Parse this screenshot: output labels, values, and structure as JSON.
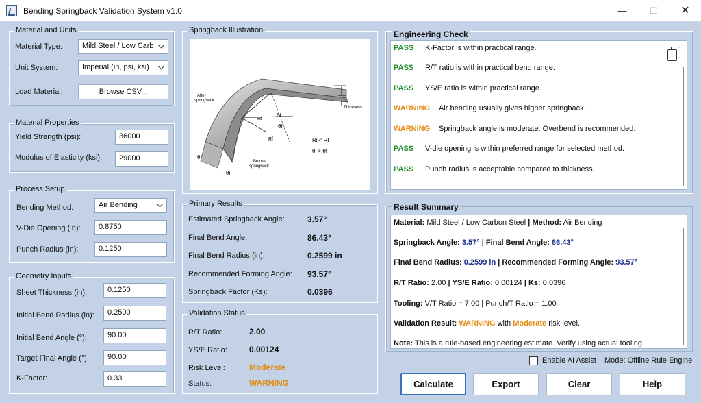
{
  "window": {
    "title": "Bending Springback Validation System v1.0",
    "min": "—",
    "max": "☐",
    "close": "✕"
  },
  "material_units": {
    "title": "Material and Units",
    "material_type_label": "Material Type:",
    "material_type_value": "Mild Steel / Low Carbon Steel",
    "unit_system_label": "Unit System:",
    "unit_system_value": "Imperial (in, psi, ksi)",
    "load_label": "Load Material:",
    "browse_button": "Browse CSV..."
  },
  "material_props": {
    "title": "Material Properties",
    "yield_label": "Yield Strength (psi):",
    "yield_value": "36000",
    "modulus_label": "Modulus of Elasticity (ksi):",
    "modulus_value": "29000"
  },
  "process": {
    "title": "Process Setup",
    "method_label": "Bending Method:",
    "method_value": "Air Bending",
    "vdie_label": "V-Die Opening (in):",
    "vdie_value": "0.8750",
    "punch_label": "Punch Radius (in):",
    "punch_value": "0.1250"
  },
  "geometry": {
    "title": "Geometry Inputs",
    "thickness_label": "Sheet Thickness (in):",
    "thickness_value": "0.1250",
    "radius_label": "Initial Bend Radius (in):",
    "radius_value": "0.2500",
    "angle_label": "Initial Bend Angle (°):",
    "angle_value": "90.00",
    "target_label": "Target Final Angle (°)",
    "target_value": "90.00",
    "kfactor_label": "K-Factor:",
    "kfactor_value": "0.33"
  },
  "illustration": {
    "title": "Springback Illustration",
    "after": "After",
    "after2": "springback",
    "before": "Before",
    "before2": "springback",
    "thickness": "Thickness",
    "ri": "Ri",
    "rf": "Rf",
    "thi": "θi",
    "thf": "θf",
    "thf2": "θf",
    "thi2": "θi",
    "rel1": "Ri < Rf",
    "rel2": "θi > θf"
  },
  "primary_results": {
    "title": "Primary Results",
    "rows": [
      {
        "label": "Estimated Springback Angle:",
        "value": "3.57°"
      },
      {
        "label": "Final Bend Angle:",
        "value": "86.43°"
      },
      {
        "label": "Final Bend Radius (in):",
        "value": "0.2599 in"
      },
      {
        "label": "Recommended Forming Angle:",
        "value": "93.57°"
      },
      {
        "label": "Springback Factor (Ks):",
        "value": "0.0396"
      }
    ]
  },
  "validation": {
    "title": "Validation Status",
    "rt_label": "R/T Ratio:",
    "rt_value": "2.00",
    "yse_label": "YS/E Ratio:",
    "yse_value": "0.00124",
    "risk_label": "Risk Level:",
    "risk_value": "Moderate",
    "status_label": "Status:",
    "status_value": "WARNING"
  },
  "engineering_check": {
    "title": "Engineering Check",
    "rows": [
      {
        "status": "PASS",
        "text": "K-Factor is within practical range."
      },
      {
        "status": "PASS",
        "text": "R/T ratio is within practical bend range."
      },
      {
        "status": "PASS",
        "text": "YS/E ratio is within practical range."
      },
      {
        "status": "WARNING",
        "text": "Air bending usually gives higher springback."
      },
      {
        "status": "WARNING",
        "text": "Springback angle is moderate. Overbend is recommended."
      },
      {
        "status": "PASS",
        "text": "V-die opening is within preferred range for selected method."
      },
      {
        "status": "PASS",
        "text": "Punch radius is acceptable compared to thickness."
      }
    ]
  },
  "result_summary": {
    "title": "Result Summary",
    "material_key": "Material:",
    "material_val": "Mild Steel / Low Carbon Steel",
    "sep": "|",
    "method_key": "Method:",
    "method_val": "Air Bending",
    "sb_key": "Springback Angle:",
    "sb_val": "3.57°",
    "fba_key": "Final Bend Angle:",
    "fba_val": "86.43°",
    "fbr_key": "Final Bend Radius:",
    "fbr_val": "0.2599 in",
    "rfa_key": "Recommended Forming Angle:",
    "rfa_val": "93.57°",
    "rt_key": "R/T Ratio:",
    "rt_val": "2.00",
    "yse_key": "YS/E Ratio:",
    "yse_val": "0.00124",
    "ks_key": "Ks:",
    "ks_val": "0.0396",
    "tool_key": "Tooling:",
    "tool_val": "V/T Ratio = 7.00 | Punch/T Ratio = 1.00",
    "vr_key": "Validation Result:",
    "vr_status": "WARNING",
    "vr_mid": "with",
    "vr_risk": "Moderate",
    "vr_end": "risk level.",
    "note_key": "Note:",
    "note_val": "This is a rule-based engineering estimate. Verify using actual tooling,"
  },
  "footer": {
    "ai_assist": "Enable AI Assist",
    "mode": "Mode: Offline Rule Engine",
    "calculate": "Calculate",
    "export": "Export",
    "clear": "Clear",
    "help": "Help"
  }
}
